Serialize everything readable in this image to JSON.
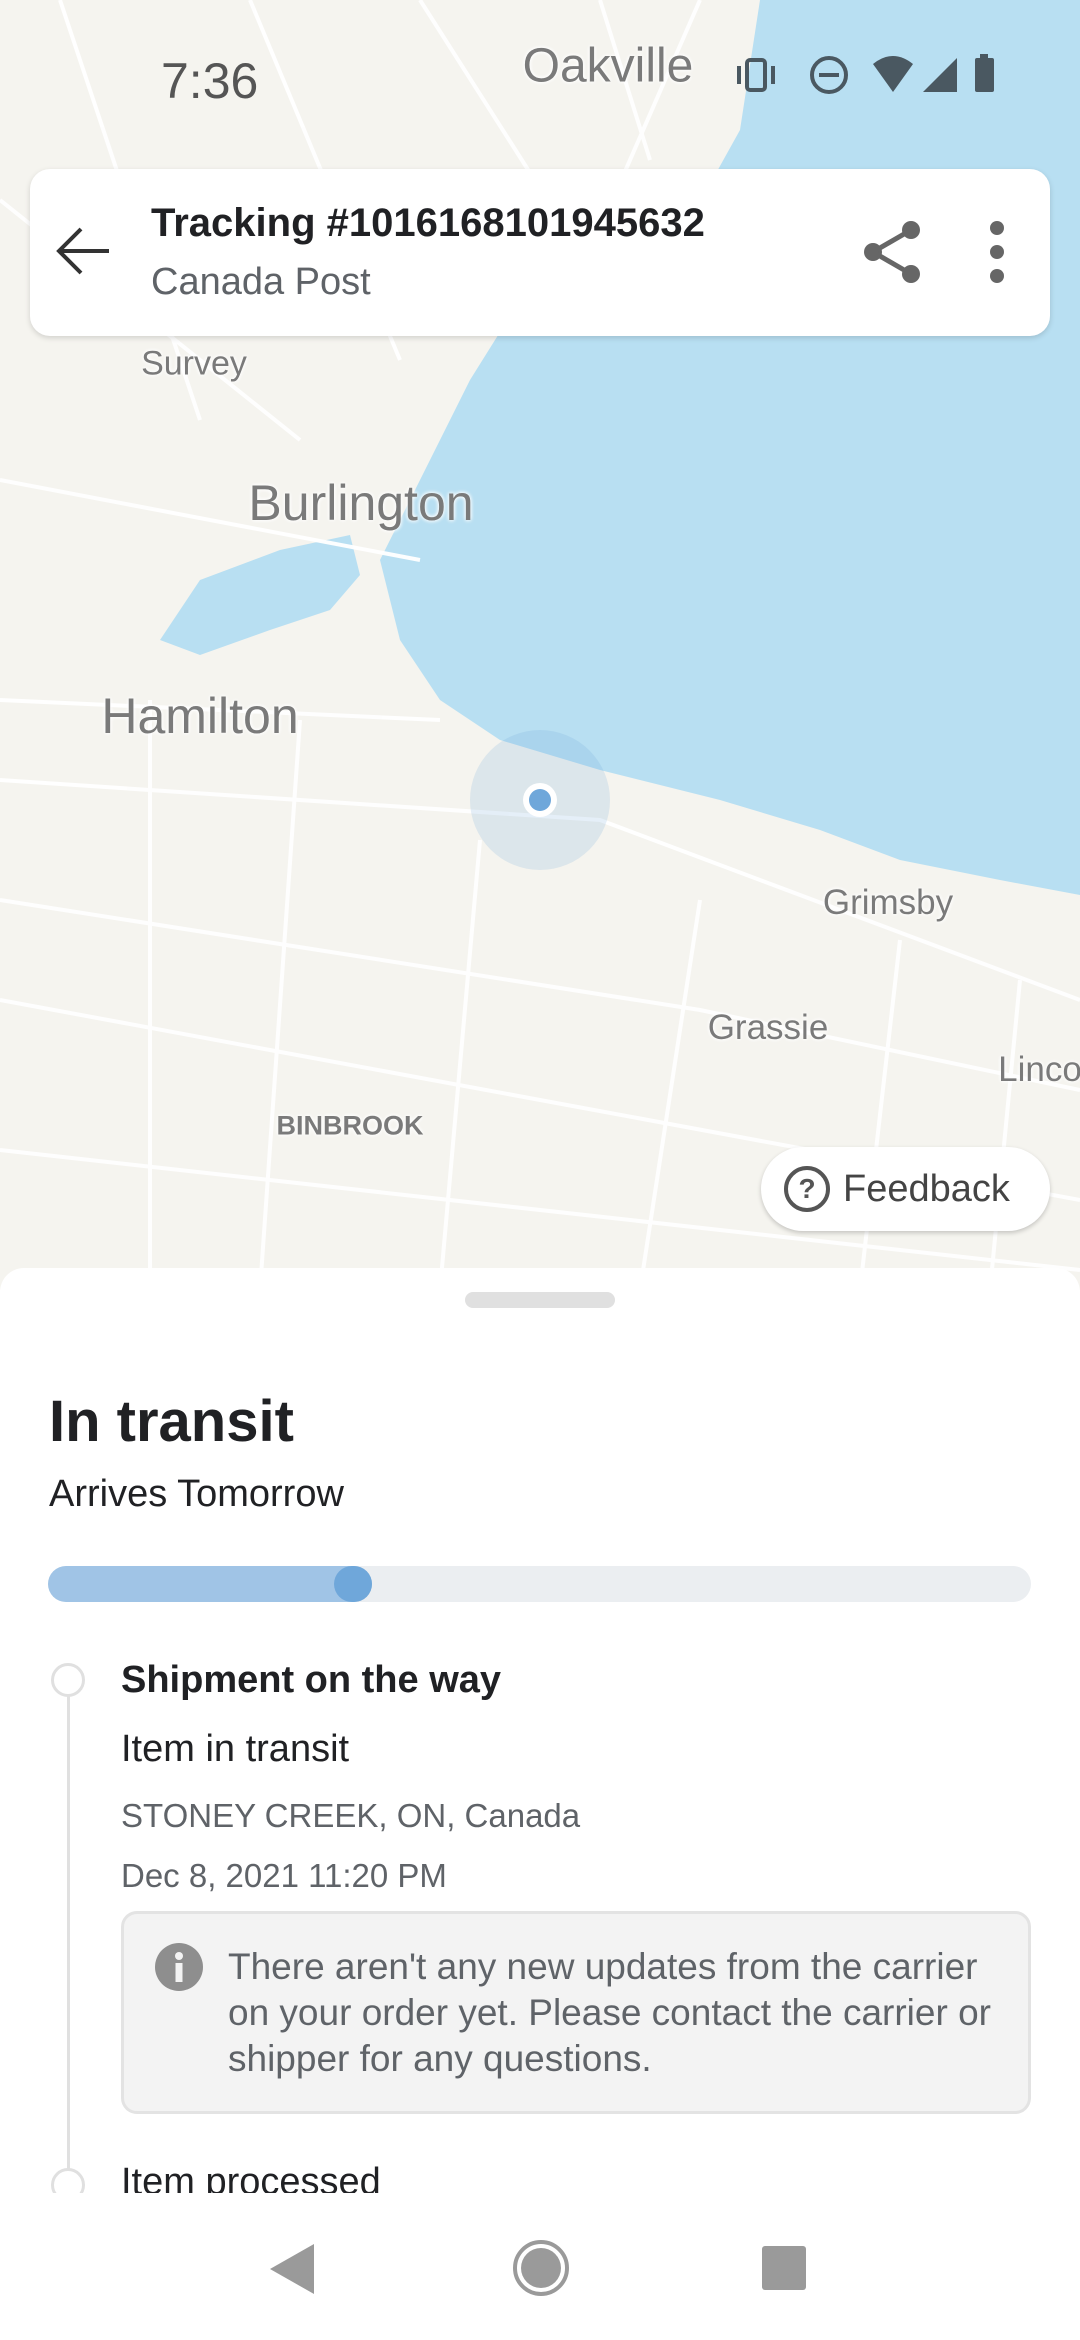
{
  "status_bar": {
    "time": "7:36",
    "icons": [
      "vibrate-icon",
      "do-not-disturb-icon",
      "wifi-icon",
      "cell-signal-icon",
      "battery-icon"
    ]
  },
  "map": {
    "labels": {
      "oakville": "Oakville",
      "survey": "Survey",
      "burlington": "Burlington",
      "hamilton": "Hamilton",
      "grimsby": "Grimsby",
      "grassie": "Grassie",
      "linco": "Linco",
      "binbrook": "BINBROOK"
    },
    "water_color": "#b8dff2",
    "land_color": "#f5f4ef",
    "location_color": "#6fa7da"
  },
  "header": {
    "title": "Tracking #1016168101945632",
    "subtitle": "Canada Post",
    "back_icon": "arrow-left-icon",
    "share_icon": "share-icon",
    "more_icon": "more-vert-icon"
  },
  "feedback": {
    "label": "Feedback",
    "icon": "help-circle-icon"
  },
  "sheet": {
    "status": "In transit",
    "eta": "Arrives Tomorrow",
    "progress": 0.33,
    "events": [
      {
        "title": "Shipment on the way",
        "detail": "Item in transit",
        "location": "STONEY CREEK, ON, Canada",
        "datetime": "Dec 8, 2021 11:20 PM"
      },
      {
        "title": "Item processed"
      }
    ],
    "info_message": "There aren't any new updates from the carrier on your order yet. Please contact the carrier or shipper for any questions."
  },
  "nav": {
    "back": "nav-back-icon",
    "home": "nav-home-icon",
    "recents": "nav-recents-icon"
  }
}
